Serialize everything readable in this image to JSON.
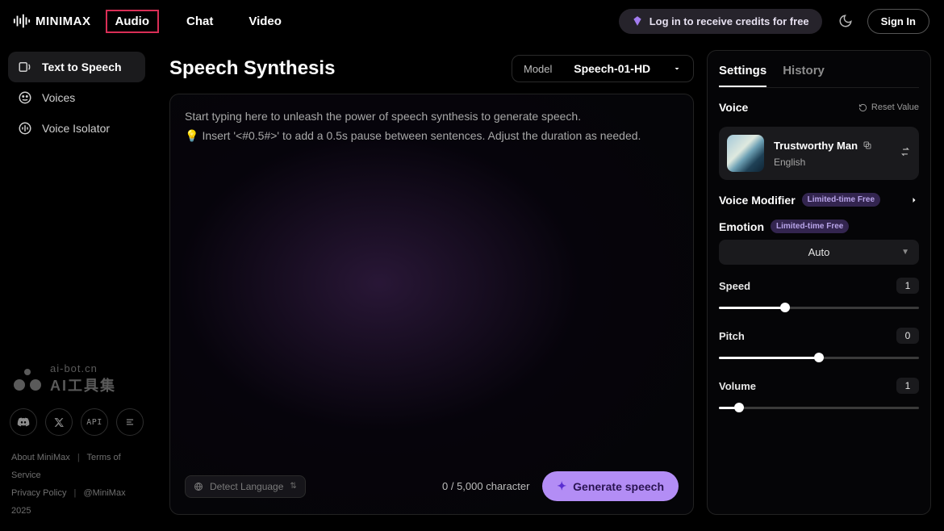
{
  "brand": "MINIMAX",
  "nav": {
    "audio": "Audio",
    "chat": "Chat",
    "video": "Video"
  },
  "header": {
    "credits": "Log in to receive credits for free",
    "signin": "Sign In"
  },
  "sidebar": {
    "items": [
      {
        "label": "Text to Speech"
      },
      {
        "label": "Voices"
      },
      {
        "label": "Voice Isolator"
      }
    ]
  },
  "watermark": {
    "url": "ai-bot.cn",
    "cn": "AI工具集"
  },
  "social": {
    "api": "API"
  },
  "footer": {
    "about": "About MiniMax",
    "terms": "Terms of Service",
    "privacy": "Privacy Policy",
    "copyright": "@MiniMax 2025"
  },
  "page": {
    "title": "Speech Synthesis",
    "model_label": "Model",
    "model_value": "Speech-01-HD",
    "placeholder": "Start typing here to unleash the power of speech synthesis to generate speech.",
    "hint": "Insert '<#0.5#>' to add a 0.5s pause between sentences. Adjust the duration as needed.",
    "lang_detect": "Detect Language",
    "char_count": "0 / 5,000 character",
    "generate": "Generate speech"
  },
  "panel": {
    "tabs": {
      "settings": "Settings",
      "history": "History"
    },
    "voice_label": "Voice",
    "reset": "Reset Value",
    "voice_name": "Trustworthy Man",
    "voice_lang": "English",
    "modifier_label": "Voice Modifier",
    "limited_badge": "Limited-time Free",
    "emotion_label": "Emotion",
    "emotion_value": "Auto",
    "speed": {
      "label": "Speed",
      "value": "1",
      "percent": 33
    },
    "pitch": {
      "label": "Pitch",
      "value": "0",
      "percent": 50
    },
    "volume": {
      "label": "Volume",
      "value": "1",
      "percent": 10
    }
  }
}
